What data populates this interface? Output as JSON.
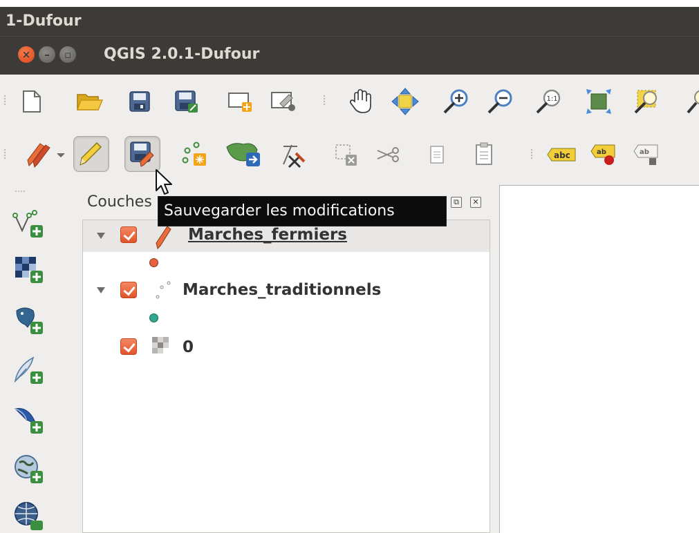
{
  "window": {
    "outer_title": "1-Dufour",
    "app_title": "QGIS 2.0.1-Dufour",
    "controls": [
      "close",
      "minimize",
      "maximize"
    ]
  },
  "toolbar_file_nav": {
    "buttons": [
      "new-project-icon",
      "open-project-icon",
      "save-project-icon",
      "save-as-icon",
      "new-print-composer-icon",
      "composer-manager-icon",
      "pan-icon",
      "pan-to-selection-icon",
      "zoom-in-icon",
      "zoom-out-icon",
      "zoom-actual-size-icon",
      "zoom-full-icon",
      "zoom-to-layer-icon"
    ]
  },
  "toolbar_digitizing": {
    "buttons": [
      "current-edits-dropdown-icon",
      "toggle-editing-icon",
      "save-edits-icon",
      "add-feature-icon",
      "node-tool-icon",
      "digitize-tool-icon",
      "delete-selected-icon",
      "cut-features-icon",
      "copy-features-icon",
      "paste-features-icon"
    ],
    "label_tools": [
      "abc",
      "ab",
      "ab"
    ]
  },
  "side_toolbar": {
    "buttons": [
      "add-vector-layer-icon",
      "add-raster-layer-icon",
      "add-postgis-layer-icon",
      "add-spatialite-layer-icon",
      "add-mssql-layer-icon",
      "add-wms-layer-icon",
      "add-wcs-layer-icon"
    ]
  },
  "layers_panel": {
    "title": "Couches",
    "layers": [
      {
        "name": "Marches_fermiers",
        "visible": true,
        "editing": true,
        "symbol_color": "#e8603c"
      },
      {
        "name": "Marches_traditionnels",
        "visible": true,
        "editing": false,
        "symbol_color": "#2ea88e"
      },
      {
        "name": "0",
        "visible": true,
        "editing": false
      }
    ]
  },
  "tooltip": {
    "text": "Sauvegarder les modifications"
  },
  "colors": {
    "titlebar": "#3c3b37",
    "toolbar": "#efeeec",
    "checkbox": "#e8603c",
    "tooltip_bg": "#0c0c0c"
  }
}
